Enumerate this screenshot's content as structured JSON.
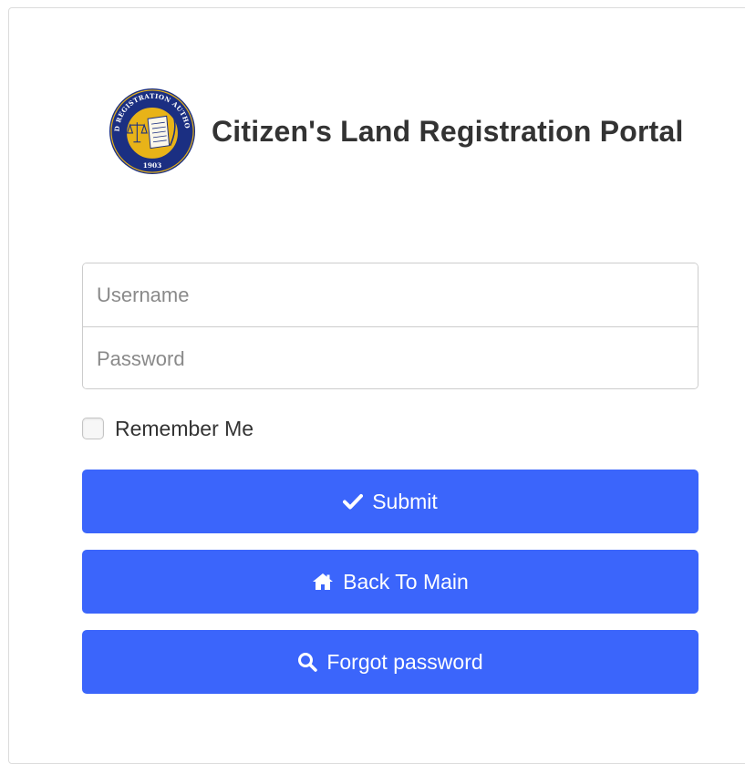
{
  "colors": {
    "primary_button": "#3b65fb",
    "seal_navy": "#1b2f82",
    "seal_gold": "#e8b318"
  },
  "logo": {
    "seal_text_top": "LAND REGISTRATION AUTHORITY",
    "seal_year": "1903"
  },
  "header": {
    "title": "Citizen's Land Registration Portal"
  },
  "form": {
    "username": {
      "placeholder": "Username",
      "value": ""
    },
    "password": {
      "placeholder": "Password",
      "value": ""
    },
    "remember_me": {
      "label": "Remember Me",
      "checked": false
    }
  },
  "buttons": {
    "submit": {
      "label": "Submit",
      "icon": "check-icon"
    },
    "back_to_main": {
      "label": "Back To Main",
      "icon": "home-icon"
    },
    "forgot_password": {
      "label": "Forgot password",
      "icon": "search-icon"
    }
  }
}
